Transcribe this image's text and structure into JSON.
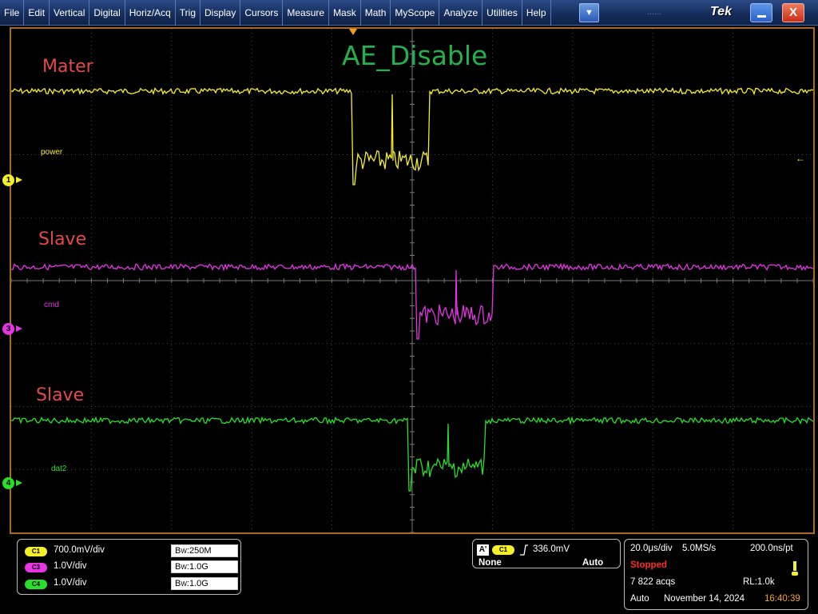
{
  "menu": {
    "items": [
      "File",
      "Edit",
      "Vertical",
      "Digital",
      "Horiz/Acq",
      "Trig",
      "Display",
      "Cursors",
      "Measure",
      "Mask",
      "Math",
      "MyScope",
      "Analyze",
      "Utilities",
      "Help"
    ],
    "dropdown_icon": "chevron-down-icon",
    "ghost_text": "......",
    "brand": "Tek",
    "minimize_icon": "minimize-icon",
    "close_label": "X"
  },
  "screen": {
    "title": "AE_Disable",
    "title_color": "#23b04e",
    "notes": [
      "Mater",
      "Slave",
      "Slave"
    ],
    "note_color": "#e54a4a",
    "channels": [
      {
        "marker": "1",
        "label": "power",
        "color": "#f5ef2a"
      },
      {
        "marker": "3",
        "label": "cmd",
        "color": "#e535e5"
      },
      {
        "marker": "4",
        "label": "dat2",
        "color": "#28e028"
      }
    ],
    "trigger_level_icon": "←"
  },
  "vertical": {
    "channels": [
      {
        "badge": "C1",
        "scale": "700.0mV/div",
        "bw_prefix": "B",
        "bw_sub": "W",
        "bw": ":250M",
        "color": "#f5ef2a"
      },
      {
        "badge": "C3",
        "scale": "1.0V/div",
        "bw_prefix": "B",
        "bw_sub": "W",
        "bw": ":1.0G",
        "color": "#e535e5"
      },
      {
        "badge": "C4",
        "scale": "1.0V/div",
        "bw_prefix": "B",
        "bw_sub": "W",
        "bw": ":1.0G",
        "color": "#28e028"
      }
    ]
  },
  "trigger": {
    "type_badge": "A'",
    "source": "C1",
    "slope_icon": "rising-edge-icon",
    "level": "336.0mV",
    "coupling": "None",
    "mode": "Auto"
  },
  "timebase": {
    "scale": "20.0μs/div",
    "sample_rate": "5.0MS/s",
    "resolution": "200.0ns/pt",
    "state": "Stopped",
    "state_color": "#ff2a2a",
    "acqs": "7 822 acqs",
    "record_length": "RL:1.0k",
    "acq_mode": "Auto",
    "date": "November 14, 2024",
    "time": "16:40:39",
    "time_color": "#f5a623",
    "indicator_icon": "trigger-status-icon"
  }
}
